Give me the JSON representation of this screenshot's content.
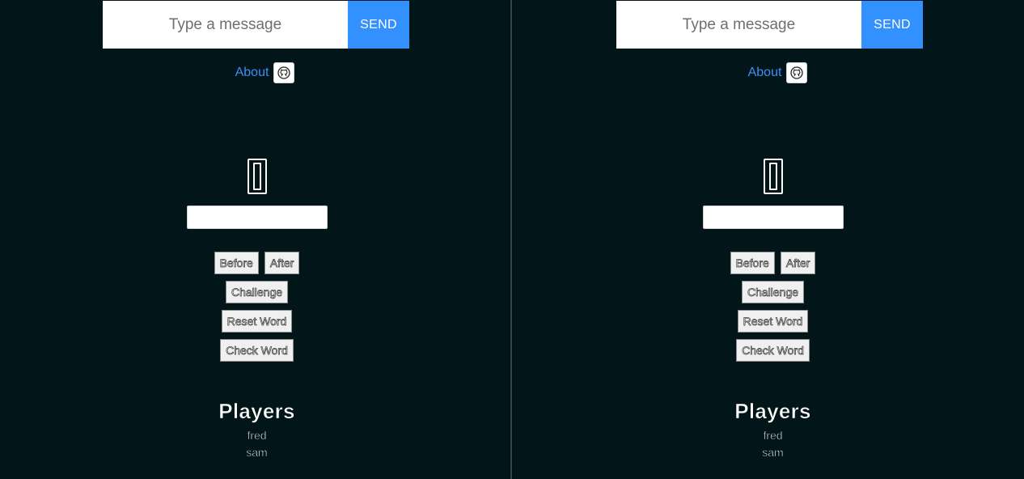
{
  "panes": [
    {
      "chat": {
        "placeholder": "Type a message",
        "send_label": "SEND"
      },
      "about_label": "About",
      "buttons": {
        "before": "Before",
        "after": "After",
        "challenge": "Challenge",
        "reset": "Reset Word",
        "check": "Check Word"
      },
      "players_title": "Players",
      "players": [
        "fred",
        "sam"
      ]
    },
    {
      "chat": {
        "placeholder": "Type a message",
        "send_label": "SEND"
      },
      "about_label": "About",
      "buttons": {
        "before": "Before",
        "after": "After",
        "challenge": "Challenge",
        "reset": "Reset Word",
        "check": "Check Word"
      },
      "players_title": "Players",
      "players": [
        "fred",
        "sam"
      ]
    }
  ],
  "icons": {
    "github": "github-icon"
  },
  "colors": {
    "background": "#021518",
    "send_button": "#3390ff",
    "link": "#3d8ef5"
  }
}
